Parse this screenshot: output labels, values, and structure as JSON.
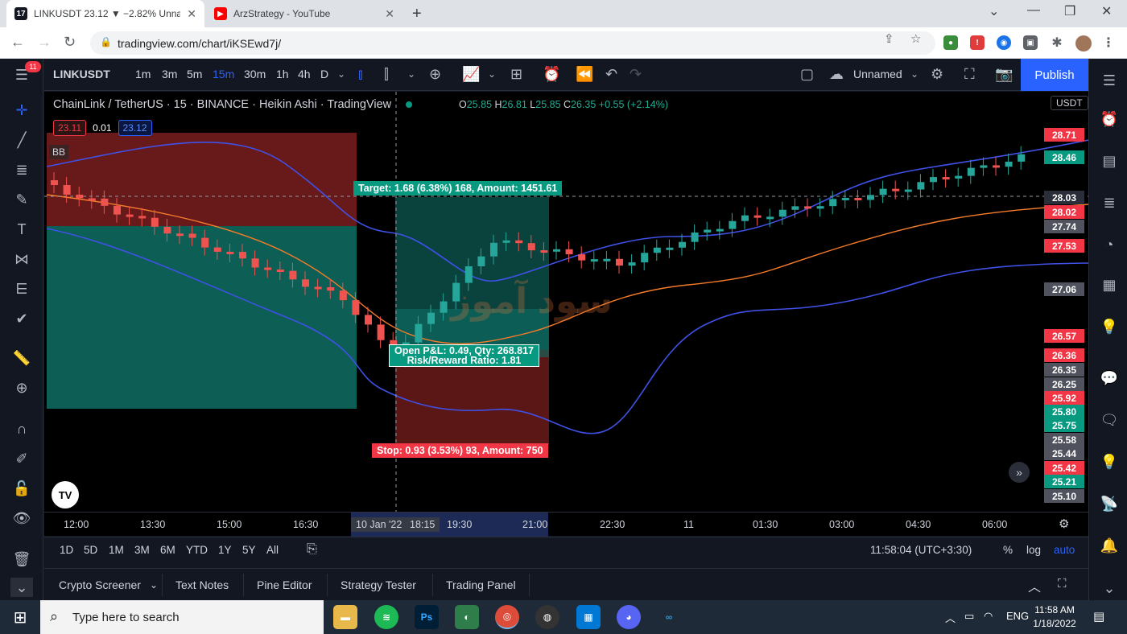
{
  "browser": {
    "tabs": [
      {
        "label": "LINKUSDT 23.12 ▼ −2.82% Unna",
        "active": true
      },
      {
        "label": "ArzStrategy - YouTube",
        "active": false
      }
    ],
    "url": "tradingview.com/chart/iKSEwd7j/"
  },
  "tv": {
    "badge": "11",
    "symbol": "LINKUSDT",
    "intervals": [
      "1m",
      "3m",
      "5m",
      "15m",
      "30m",
      "1h",
      "4h",
      "D"
    ],
    "active_interval": "15m",
    "layout_name": "Unnamed",
    "publish_label": "Publish",
    "legend_title": "ChainLink / TetherUS · 15 · BINANCE · Heikin Ashi · TradingView",
    "ohlc": {
      "o_label": "O",
      "o": "25.85",
      "h_label": "H",
      "h": "26.81",
      "l_label": "L",
      "l": "25.85",
      "c_label": "C",
      "c": "26.35",
      "chg": "+0.55 (+2.14%)"
    },
    "bid": "23.11",
    "spread": "0.01",
    "ask": "23.12",
    "indicator": "BB",
    "currency": "USDT",
    "target_label": "Target: 1.68 (6.38%) 168, Amount: 1451.61",
    "stop_label": "Stop: 0.93 (3.53%) 93, Amount: 750",
    "pnl_line1": "Open P&L: 0.49, Qty: 268.817",
    "pnl_line2": "Risk/Reward Ratio: 1.81",
    "watermark": "سود آموز",
    "logo": "TV",
    "price_tags": [
      {
        "v": "28.71",
        "c": "#f23645"
      },
      {
        "v": "28.46",
        "c": "#089981"
      },
      {
        "v": "28.03",
        "c": "#2a2e39"
      },
      {
        "v": "28.02",
        "c": "#f23645"
      },
      {
        "v": "27.74",
        "c": "#50535e"
      },
      {
        "v": "27.53",
        "c": "#f23645"
      },
      {
        "v": "27.06",
        "c": "#50535e"
      },
      {
        "v": "26.57",
        "c": "#f23645"
      },
      {
        "v": "26.36",
        "c": "#f23645"
      },
      {
        "v": "26.35",
        "c": "#50535e"
      },
      {
        "v": "26.25",
        "c": "#50535e"
      },
      {
        "v": "25.92",
        "c": "#f23645"
      },
      {
        "v": "25.80",
        "c": "#089981"
      },
      {
        "v": "25.75",
        "c": "#089981"
      },
      {
        "v": "25.58",
        "c": "#50535e"
      },
      {
        "v": "25.44",
        "c": "#50535e"
      },
      {
        "v": "25.42",
        "c": "#f23645"
      },
      {
        "v": "25.21",
        "c": "#089981"
      },
      {
        "v": "25.10",
        "c": "#50535e"
      }
    ],
    "time_labels": [
      "12:00",
      "13:30",
      "15:00",
      "16:30",
      "10 Jan '22",
      "18:15",
      "19:30",
      "21:00",
      "22:30",
      "11",
      "01:30",
      "03:00",
      "04:30",
      "06:00"
    ],
    "ranges": [
      "1D",
      "5D",
      "1M",
      "3M",
      "6M",
      "YTD",
      "1Y",
      "5Y",
      "All"
    ],
    "clock": "11:58:04 (UTC+3:30)",
    "scale_opts": [
      "%",
      "log",
      "auto"
    ],
    "bottom_tabs": [
      "Crypto Screener",
      "Text Notes",
      "Pine Editor",
      "Strategy Tester",
      "Trading Panel"
    ]
  },
  "taskbar": {
    "search_placeholder": "Type here to search",
    "lang": "ENG",
    "time": "11:58 AM",
    "date": "1/18/2022"
  }
}
